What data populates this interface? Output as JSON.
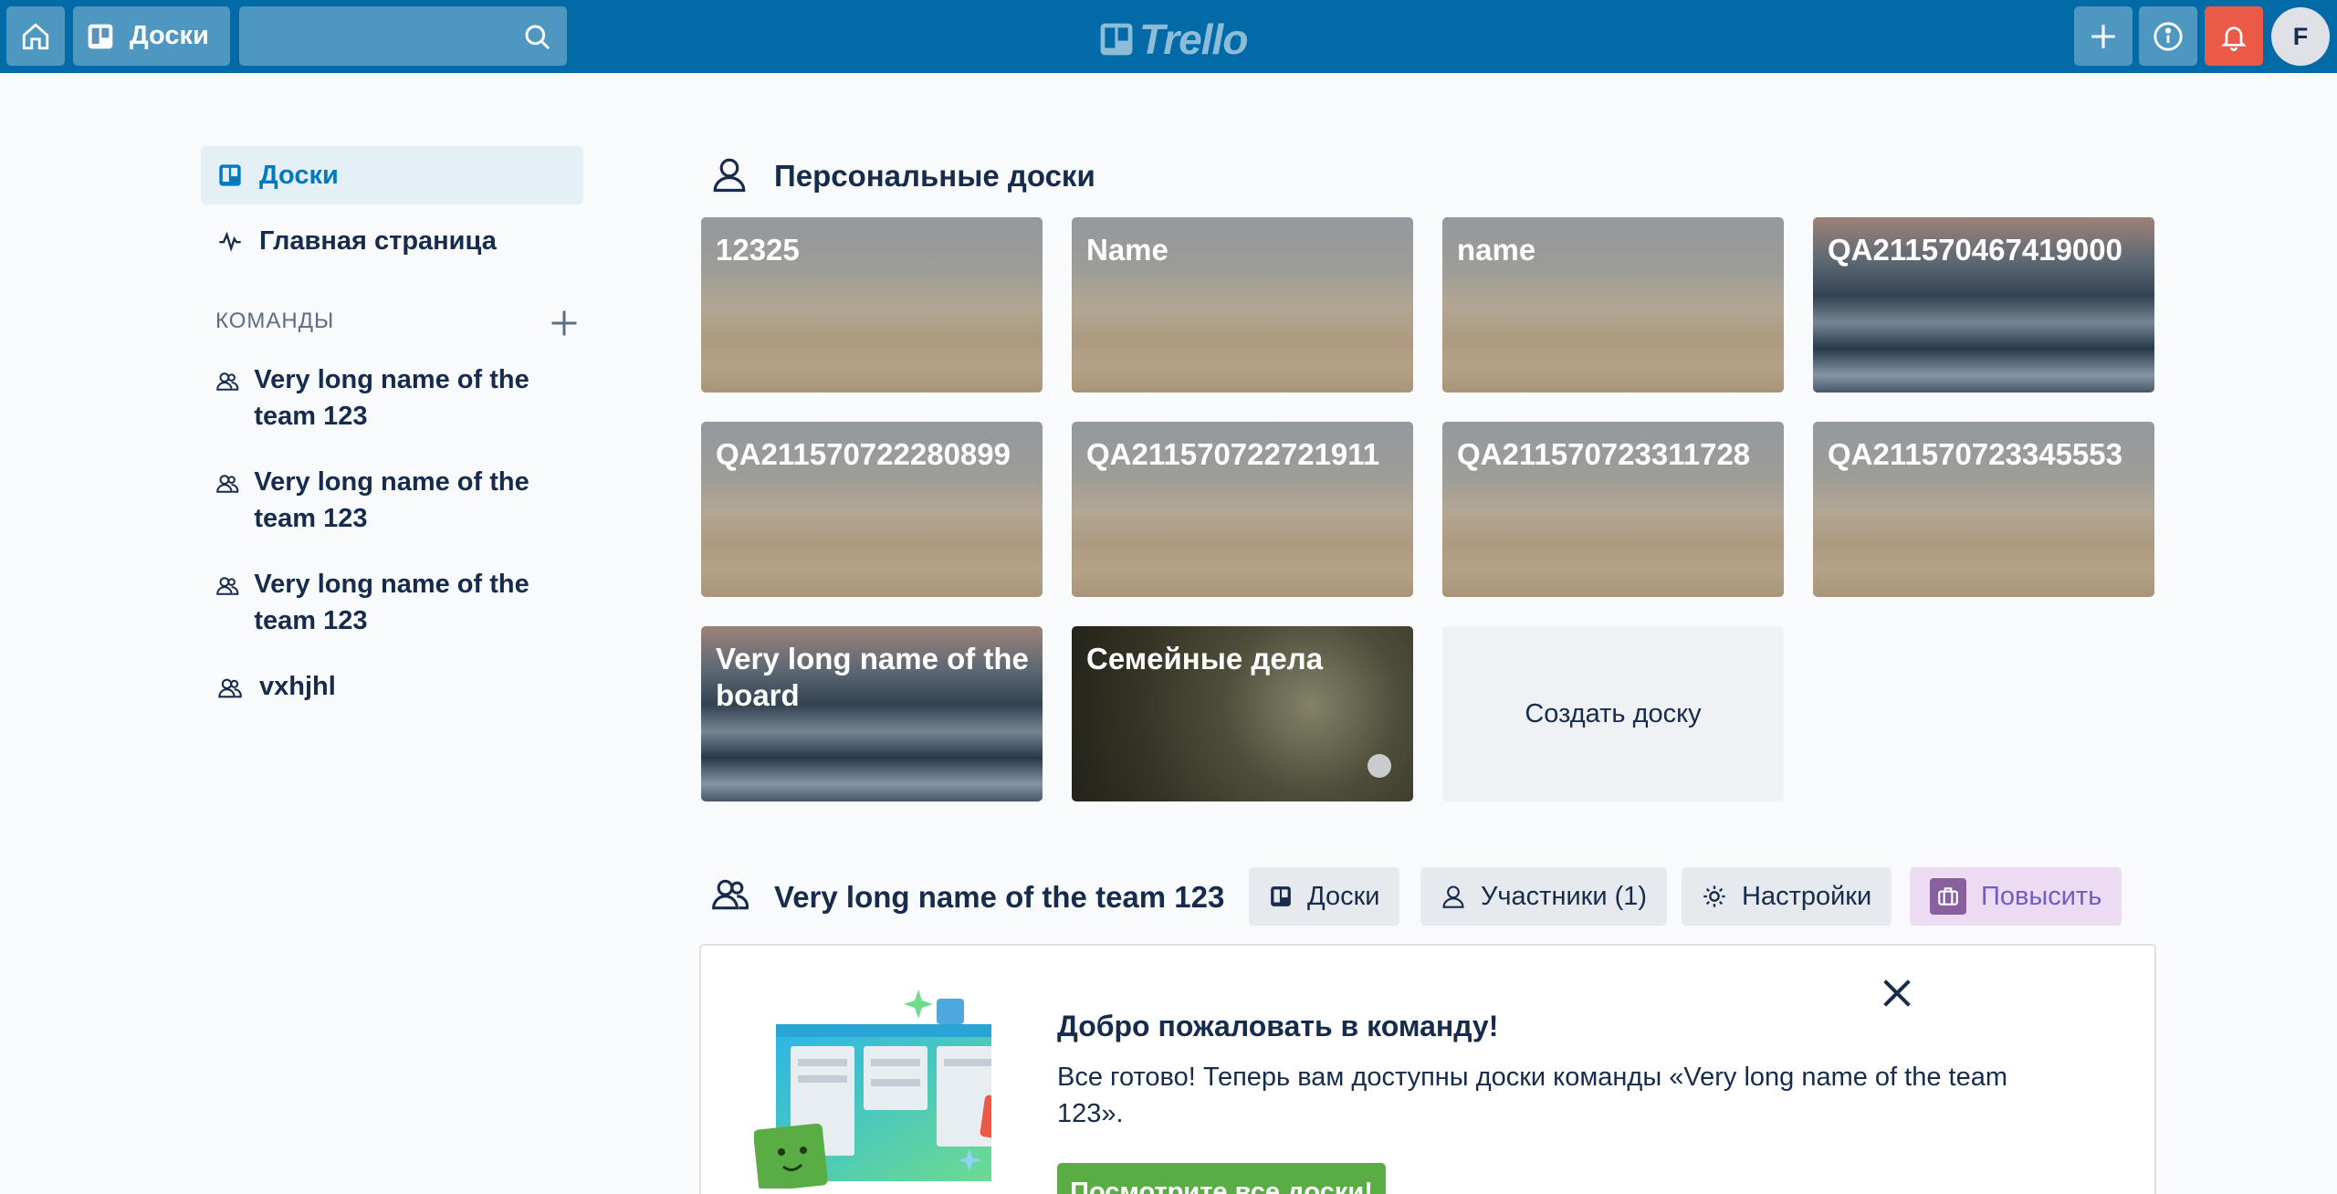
{
  "header": {
    "boards_label": "Доски",
    "search_value": "",
    "logo_text": "Trello",
    "avatar_initial": "F"
  },
  "sidebar": {
    "boards_label": "Доски",
    "home_label": "Главная страница",
    "teams_heading": "КОМАНДЫ",
    "teams": [
      {
        "label": "Very long name of the team 123"
      },
      {
        "label": "Very long name of the team 123"
      },
      {
        "label": "Very long name of the team 123"
      },
      {
        "label": "vxhjhl"
      }
    ]
  },
  "personal": {
    "title": "Персональные доски",
    "boards": [
      {
        "name": "12325",
        "background": "desert"
      },
      {
        "name": "Name",
        "background": "desert"
      },
      {
        "name": "name",
        "background": "desert"
      },
      {
        "name": "QA21157046741900​0",
        "background": "mountain"
      },
      {
        "name": "QA21157072228089​9",
        "background": "desert"
      },
      {
        "name": "QA211570722721911",
        "background": "desert"
      },
      {
        "name": "QA211570723311728",
        "background": "desert"
      },
      {
        "name": "QA211570723345553",
        "background": "desert"
      },
      {
        "name": "Very long name of the board",
        "background": "mountain"
      },
      {
        "name": "Семейные дела",
        "background": "family"
      }
    ],
    "create_label": "Создать доску"
  },
  "team_section": {
    "title": "Very long name of the team 123",
    "tabs": {
      "boards": "Доски",
      "members": "Участники (1)",
      "settings": "Настройки",
      "upgrade": "Повысить"
    }
  },
  "welcome": {
    "title": "Добро пожаловать в команду!",
    "text": "Все готово! Теперь вам доступны доски команды «Very long name of the team 123».",
    "button_label": "Посмотрите все доски!"
  },
  "colors": {
    "header_bg": "#026aa7",
    "accent": "#0079bf",
    "notification": "#eb5a46",
    "success": "#5aac44",
    "upgrade": "#89609e"
  }
}
